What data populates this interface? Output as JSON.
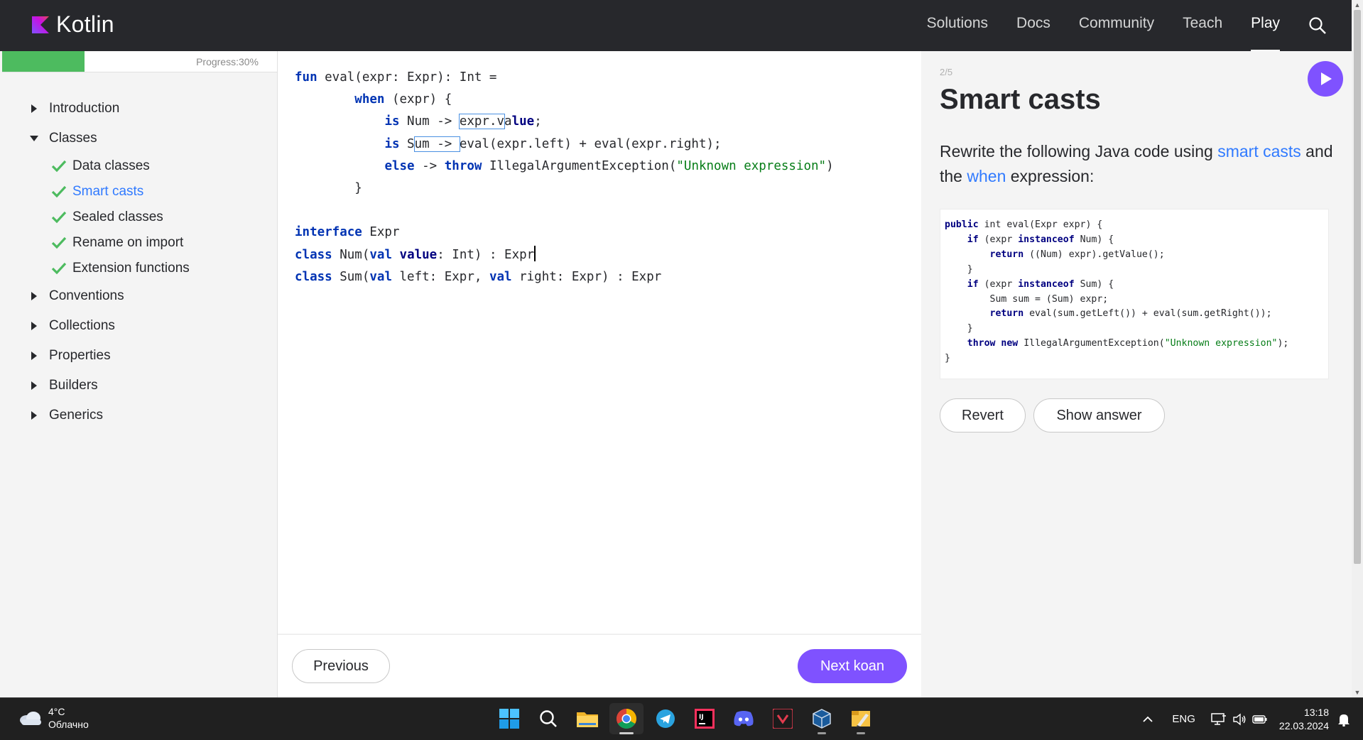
{
  "header": {
    "logo_text": "Kotlin",
    "nav": [
      "Solutions",
      "Docs",
      "Community",
      "Teach",
      "Play"
    ],
    "active_nav": "Play"
  },
  "sidebar": {
    "progress_label": "Progress:30%",
    "progress_fraction": 0.3,
    "sections": [
      {
        "label": "Introduction",
        "expanded": false
      },
      {
        "label": "Classes",
        "expanded": true,
        "children": [
          {
            "label": "Data classes",
            "done": true
          },
          {
            "label": "Smart casts",
            "done": true,
            "active": true
          },
          {
            "label": "Sealed classes",
            "done": true
          },
          {
            "label": "Rename on import",
            "done": true
          },
          {
            "label": "Extension functions",
            "done": true
          }
        ]
      },
      {
        "label": "Conventions",
        "expanded": false
      },
      {
        "label": "Collections",
        "expanded": false
      },
      {
        "label": "Properties",
        "expanded": false
      },
      {
        "label": "Builders",
        "expanded": false
      },
      {
        "label": "Generics",
        "expanded": false
      }
    ]
  },
  "editor": {
    "lines": [
      "fun eval(expr: Expr): Int =",
      "        when (expr) {",
      "            is Num -> expr.value;",
      "            is Sum -> eval(expr.left) + eval(expr.right);",
      "            else -> throw IllegalArgumentException(\"Unknown expression\")",
      "        }",
      "",
      "interface Expr",
      "class Num(val value: Int) : Expr",
      "class Sum(val left: Expr, val right: Expr) : Expr"
    ],
    "previous_label": "Previous",
    "next_label": "Next koan"
  },
  "task": {
    "counter": "2/5",
    "title": "Smart casts",
    "desc_part1": "Rewrite the following Java code using ",
    "desc_link1": "smart casts",
    "desc_part2": " and the ",
    "desc_link2": "when",
    "desc_part3": " expression:",
    "java_lines": [
      "public int eval(Expr expr) {",
      "    if (expr instanceof Num) {",
      "        return ((Num) expr).getValue();",
      "    }",
      "    if (expr instanceof Sum) {",
      "        Sum sum = (Sum) expr;",
      "        return eval(sum.getLeft()) + eval(sum.getRight());",
      "    }",
      "    throw new IllegalArgumentException(\"Unknown expression\");",
      "}"
    ],
    "revert_label": "Revert",
    "answer_label": "Show answer"
  },
  "taskbar": {
    "weather_temp": "4°C",
    "weather_desc": "Облачно",
    "apps": [
      "windows-start-icon",
      "search-icon",
      "file-explorer-icon",
      "chrome-icon",
      "telegram-icon",
      "intellij-idea-icon",
      "discord-icon",
      "app-icon",
      "virtualbox-icon",
      "folder-app-icon"
    ],
    "language": "ENG",
    "time": "13:18",
    "date": "22.03.2024"
  }
}
